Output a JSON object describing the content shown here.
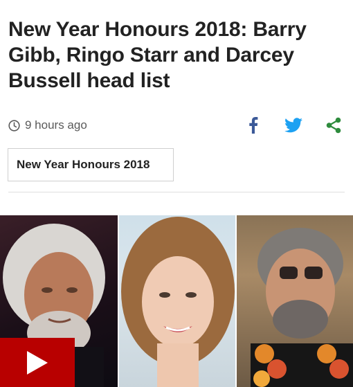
{
  "article": {
    "headline": "New Year Honours 2018: Barry Gibb, Ringo Starr and Darcey Bussell head list",
    "timestamp": "9 hours ago",
    "tag_label": "New Year Honours 2018"
  },
  "share": {
    "icons": [
      "facebook-icon",
      "twitter-icon",
      "share-icon"
    ]
  },
  "colors": {
    "brand_red": "#b80000",
    "facebook_blue": "#3b5998",
    "twitter_blue": "#1da1f2",
    "share_green": "#2e8b3d"
  }
}
